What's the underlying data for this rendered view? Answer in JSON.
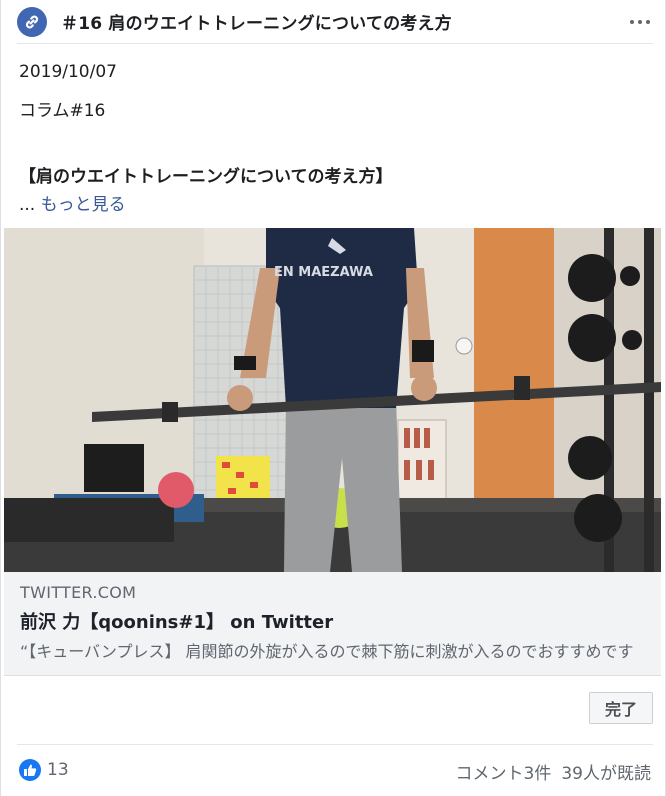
{
  "header": {
    "title": "＃16 肩のウエイトトレーニングについての考え方",
    "link_icon": "link-icon",
    "more_icon": "more-options-icon"
  },
  "post": {
    "date": "2019/10/07",
    "column": "コラム#16",
    "heading": "【肩のウエイトトレーニングについての考え方】",
    "ellipsis": "... ",
    "see_more": "もっと見る"
  },
  "media": {
    "shirt_text": "EN MAEZAWA"
  },
  "preview": {
    "domain": "TWITTER.COM",
    "title": "前沢 力【qoonins#1】 on Twitter",
    "description": "“【キューバンプレス】 肩関節の外旋が入るので棘下筋に刺激が入るのでおすすめです"
  },
  "actions": {
    "done_label": "完了"
  },
  "footer": {
    "like_count": "13",
    "comments": "コメント3件",
    "seen": "39人が既読"
  },
  "colors": {
    "link_icon_bg": "#4267b2",
    "see_more": "#385898",
    "like_icon_bg": "#1877f2"
  }
}
